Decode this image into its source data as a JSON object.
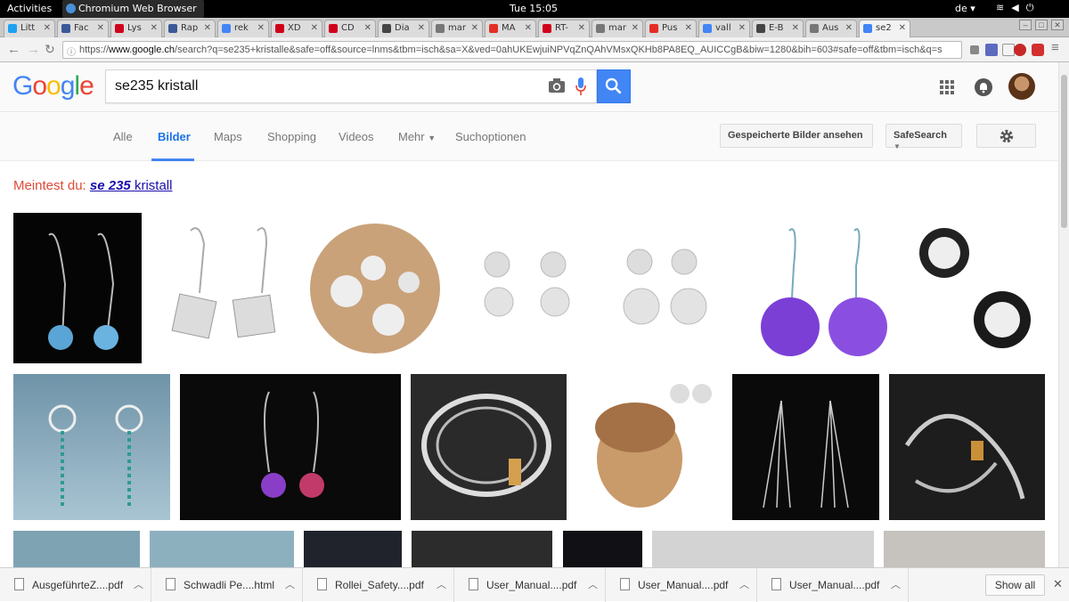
{
  "system_bar": {
    "activities": "Activities",
    "app_name": "Chromium Web Browser",
    "clock": "Tue 15:05",
    "language": "de"
  },
  "tabs": [
    {
      "label": "Litt",
      "icon": "twitter-icon",
      "color": "#1da1f2"
    },
    {
      "label": "Fac",
      "icon": "facebook-icon",
      "color": "#3b5998"
    },
    {
      "label": "Lys",
      "icon": "lys-icon",
      "color": "#d0021b"
    },
    {
      "label": "Rap",
      "icon": "facebook-icon",
      "color": "#3b5998"
    },
    {
      "label": "rek",
      "icon": "google-icon",
      "color": "#4285f4"
    },
    {
      "label": "XD",
      "icon": "dj-icon",
      "color": "#d0021b"
    },
    {
      "label": "CD",
      "icon": "dj-icon",
      "color": "#d0021b"
    },
    {
      "label": "Dia",
      "icon": "settings-icon",
      "color": "#444444"
    },
    {
      "label": "mar",
      "icon": "page-icon",
      "color": "#777777"
    },
    {
      "label": "MA",
      "icon": "youtube-icon",
      "color": "#e52d27"
    },
    {
      "label": "RT-",
      "icon": "rt-icon",
      "color": "#d0021b"
    },
    {
      "label": "mar",
      "icon": "page-icon",
      "color": "#777777"
    },
    {
      "label": "Pus",
      "icon": "youtube-icon",
      "color": "#e52d27"
    },
    {
      "label": "vall",
      "icon": "google-icon",
      "color": "#4285f4"
    },
    {
      "label": "E-B",
      "icon": "puzzle-icon",
      "color": "#444444"
    },
    {
      "label": "Aus",
      "icon": "page-icon",
      "color": "#777777"
    },
    {
      "label": "se2",
      "icon": "google-icon",
      "color": "#4285f4",
      "active": true
    }
  ],
  "address_bar": {
    "url_prefix": "https://",
    "url_host": "www.google.ch",
    "url_rest": "/search?q=se235+kristalle&safe=off&source=lnms&tbm=isch&sa=X&ved=0ahUKEwjuiNPVqZnQAhVMsxQKHb8PA8EQ_AUICCgB&biw=1280&bih=603#safe=off&tbm=isch&q=s"
  },
  "google": {
    "logo_letters": [
      "G",
      "o",
      "o",
      "g",
      "l",
      "e"
    ],
    "logo_colors": [
      "#4285f4",
      "#ea4335",
      "#fbbc05",
      "#4285f4",
      "#34a853",
      "#ea4335"
    ],
    "query": "se235 kristall",
    "search_button_color": "#4285f4"
  },
  "tabs_bar": {
    "items": [
      "Alle",
      "Bilder",
      "Maps",
      "Shopping",
      "Videos",
      "Mehr",
      "Suchoptionen"
    ],
    "selected": "Bilder",
    "saved_images_button": "Gespeicherte Bilder ansehen",
    "safesearch_button": "SafeSearch"
  },
  "spelling": {
    "prefix": "Meintest du:",
    "suggestion_bold": "se 235",
    "suggestion_rest": "kristall"
  },
  "downloads": {
    "items": [
      "AusgeführteZ....pdf",
      "Schwadli Pe....html",
      "Rollei_Safety....pdf",
      "User_Manual....pdf",
      "User_Manual....pdf",
      "User_Manual....pdf"
    ],
    "show_all": "Show all"
  }
}
